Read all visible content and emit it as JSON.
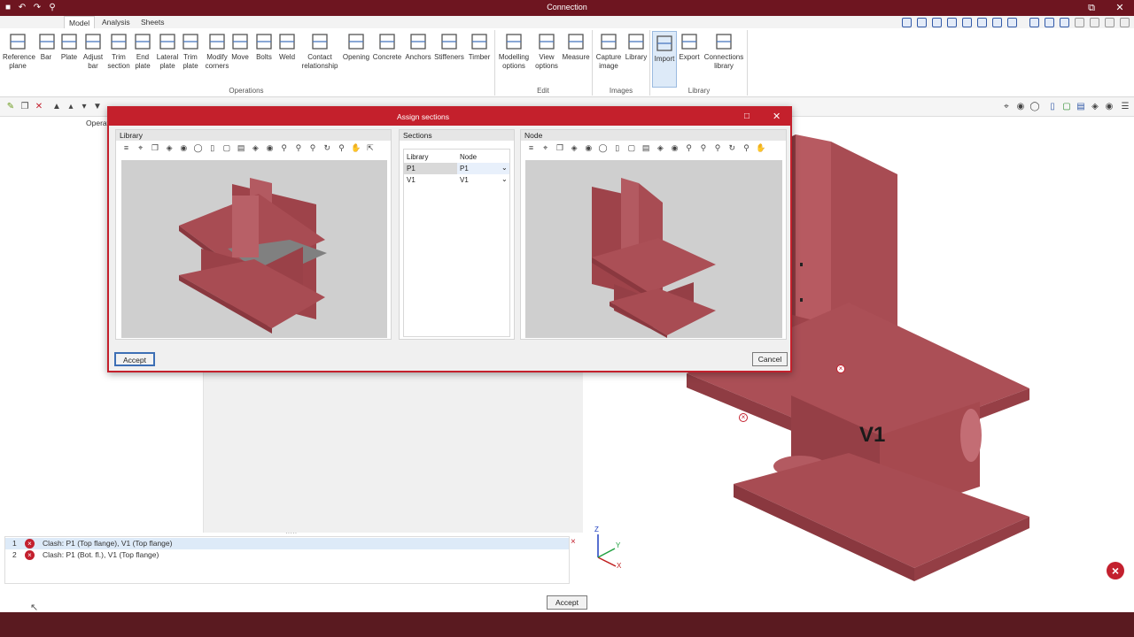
{
  "app": {
    "title": "Connection"
  },
  "tabs": [
    {
      "label": "Model",
      "active": true
    },
    {
      "label": "Analysis",
      "active": false
    },
    {
      "label": "Sheets",
      "active": false
    }
  ],
  "ribbon": {
    "buttons": [
      {
        "line1": "Reference",
        "line2": "plane",
        "icon": "reference-plane-icon"
      },
      {
        "line1": "Bar",
        "line2": "",
        "icon": "bar-icon"
      },
      {
        "line1": "Plate",
        "line2": "",
        "icon": "plate-icon"
      },
      {
        "line1": "Adjust",
        "line2": "bar",
        "icon": "adjust-bar-icon"
      },
      {
        "line1": "Trim",
        "line2": "section",
        "icon": "trim-section-icon"
      },
      {
        "line1": "End",
        "line2": "plate",
        "icon": "end-plate-icon"
      },
      {
        "line1": "Lateral",
        "line2": "plate",
        "icon": "lateral-plate-icon"
      },
      {
        "line1": "Trim",
        "line2": "plate",
        "icon": "trim-plate-icon"
      },
      {
        "line1": "Modify",
        "line2": "corners",
        "icon": "modify-corners-icon"
      },
      {
        "line1": "Move",
        "line2": "",
        "icon": "move-icon"
      },
      {
        "line1": "Bolts",
        "line2": "",
        "icon": "bolts-icon"
      },
      {
        "line1": "Weld",
        "line2": "",
        "icon": "weld-icon"
      },
      {
        "line1": "Contact",
        "line2": "relationship",
        "icon": "contact-relationship-icon"
      },
      {
        "line1": "Opening",
        "line2": "",
        "icon": "opening-icon"
      },
      {
        "line1": "Concrete",
        "line2": "",
        "icon": "concrete-icon"
      },
      {
        "line1": "Anchors",
        "line2": "",
        "icon": "anchors-icon"
      },
      {
        "line1": "Stiffeners",
        "line2": "",
        "icon": "stiffeners-icon"
      },
      {
        "line1": "Timber",
        "line2": "",
        "icon": "timber-icon"
      },
      {
        "line1": "Modelling",
        "line2": "options",
        "icon": "modelling-options-icon"
      },
      {
        "line1": "View",
        "line2": "options",
        "icon": "view-options-icon"
      },
      {
        "line1": "Measure",
        "line2": "",
        "icon": "measure-icon"
      },
      {
        "line1": "Capture",
        "line2": "image",
        "icon": "capture-image-icon"
      },
      {
        "line1": "Library",
        "line2": "",
        "icon": "library-icon"
      },
      {
        "line1": "Import",
        "line2": "",
        "icon": "import-icon"
      },
      {
        "line1": "Export",
        "line2": "",
        "icon": "export-icon"
      },
      {
        "line1": "Connections",
        "line2": "library",
        "icon": "connections-library-icon"
      }
    ],
    "groups": [
      "Operations",
      "Edit",
      "Images",
      "Library"
    ]
  },
  "left_panel": {
    "partial_label": "Operati"
  },
  "dialog": {
    "title": "Assign sections",
    "library_panel": {
      "title": "Library"
    },
    "sections_panel": {
      "title": "Sections",
      "columns": [
        "Library",
        "Node"
      ],
      "rows": [
        {
          "library": "P1",
          "node": "P1"
        },
        {
          "library": "V1",
          "node": "V1"
        }
      ]
    },
    "node_panel": {
      "title": "Node"
    },
    "accept_label": "Accept",
    "cancel_label": "Cancel"
  },
  "errors": [
    {
      "num": "1",
      "text": "Clash: P1 (Top flange), V1 (Top flange)"
    },
    {
      "num": "2",
      "text": "Clash: P1 (Bot. fl.), V1 (Top flange)"
    }
  ],
  "viewport": {
    "member_label": "V1",
    "axes": {
      "x": "X",
      "y": "Y",
      "z": "Z"
    }
  },
  "bottom_accept_label": "Accept",
  "colors": {
    "titlebar": "#6e1520",
    "dialog_accent": "#c4202c",
    "steel": "#a5484f",
    "error": "#c3202e"
  }
}
